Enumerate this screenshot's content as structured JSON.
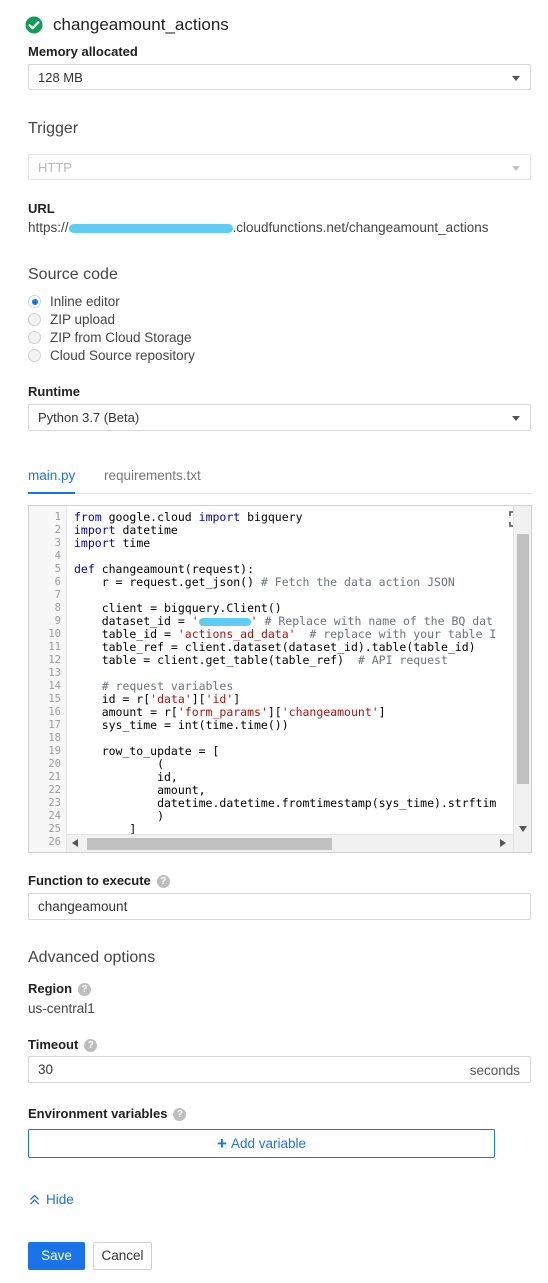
{
  "header": {
    "function_name": "changeamount_actions",
    "status_icon": "check-circle-icon",
    "status_color": "#0f9d58"
  },
  "memory": {
    "label": "Memory allocated",
    "value": "128 MB"
  },
  "trigger": {
    "title": "Trigger",
    "value": "HTTP"
  },
  "url": {
    "label": "URL",
    "prefix": "https://",
    "suffix": ".cloudfunctions.net/changeamount_actions"
  },
  "source": {
    "title": "Source code",
    "options": [
      "Inline editor",
      "ZIP upload",
      "ZIP from Cloud Storage",
      "Cloud Source repository"
    ],
    "selected": "Inline editor"
  },
  "runtime": {
    "label": "Runtime",
    "value": "Python 3.7 (Beta)"
  },
  "tabs": [
    "main.py",
    "requirements.txt"
  ],
  "active_tab": "main.py",
  "editor": {
    "line_numbers": [
      "1",
      "2",
      "3",
      "4",
      "5",
      "6",
      "7",
      "8",
      "9",
      "10",
      "11",
      "12",
      "13",
      "14",
      "15",
      "16",
      "17",
      "18",
      "19",
      "20",
      "21",
      "22",
      "23",
      "24",
      "25",
      "26"
    ],
    "code": {
      "l1a": "from",
      "l1b": " google.cloud ",
      "l1c": "import",
      "l1d": " bigquery",
      "l2a": "import",
      "l2b": " datetime",
      "l3a": "import",
      "l3b": " time",
      "l5a": "def",
      "l5b": " changeamount(request):",
      "l6a": "    r = request.get_json() ",
      "l6b": "# Fetch the data action JSON",
      "l8": "    client = bigquery.Client()",
      "l9a": "    dataset_id = ",
      "l9b": "'",
      "l9c": "'",
      "l9d": " # Replace with name of the BQ dat",
      "l10a": "    table_id = ",
      "l10b": "'actions_ad_data'",
      "l10c": "  # replace with your table I",
      "l11": "    table_ref = client.dataset(dataset_id).table(table_id)",
      "l12a": "    table = client.get_table(table_ref)  ",
      "l12b": "# API request",
      "l14": "    # request variables",
      "l15a": "    id = r[",
      "l15b": "'data'",
      "l15c": "][",
      "l15d": "'id'",
      "l15e": "]",
      "l16a": "    amount = r[",
      "l16b": "'form_params'",
      "l16c": "][",
      "l16d": "'changeamount'",
      "l16e": "]",
      "l17": "    sys_time = int(time.time())",
      "l19": "    row_to_update = [",
      "l20": "            (",
      "l21": "            id,",
      "l22": "            amount,",
      "l23": "            datetime.datetime.fromtimestamp(sys_time).strftim",
      "l24": "            )",
      "l25": "        ]"
    }
  },
  "function_to_execute": {
    "label": "Function to execute",
    "value": "changeamount"
  },
  "advanced": {
    "title": "Advanced options"
  },
  "region": {
    "label": "Region",
    "value": "us-central1"
  },
  "timeout": {
    "label": "Timeout",
    "value": "30",
    "unit": "seconds"
  },
  "env": {
    "label": "Environment variables",
    "add_label": "Add variable"
  },
  "hide_label": "Hide",
  "buttons": {
    "save": "Save",
    "cancel": "Cancel"
  },
  "colors": {
    "accent": "#1a73e8",
    "success": "#0f9d58"
  }
}
